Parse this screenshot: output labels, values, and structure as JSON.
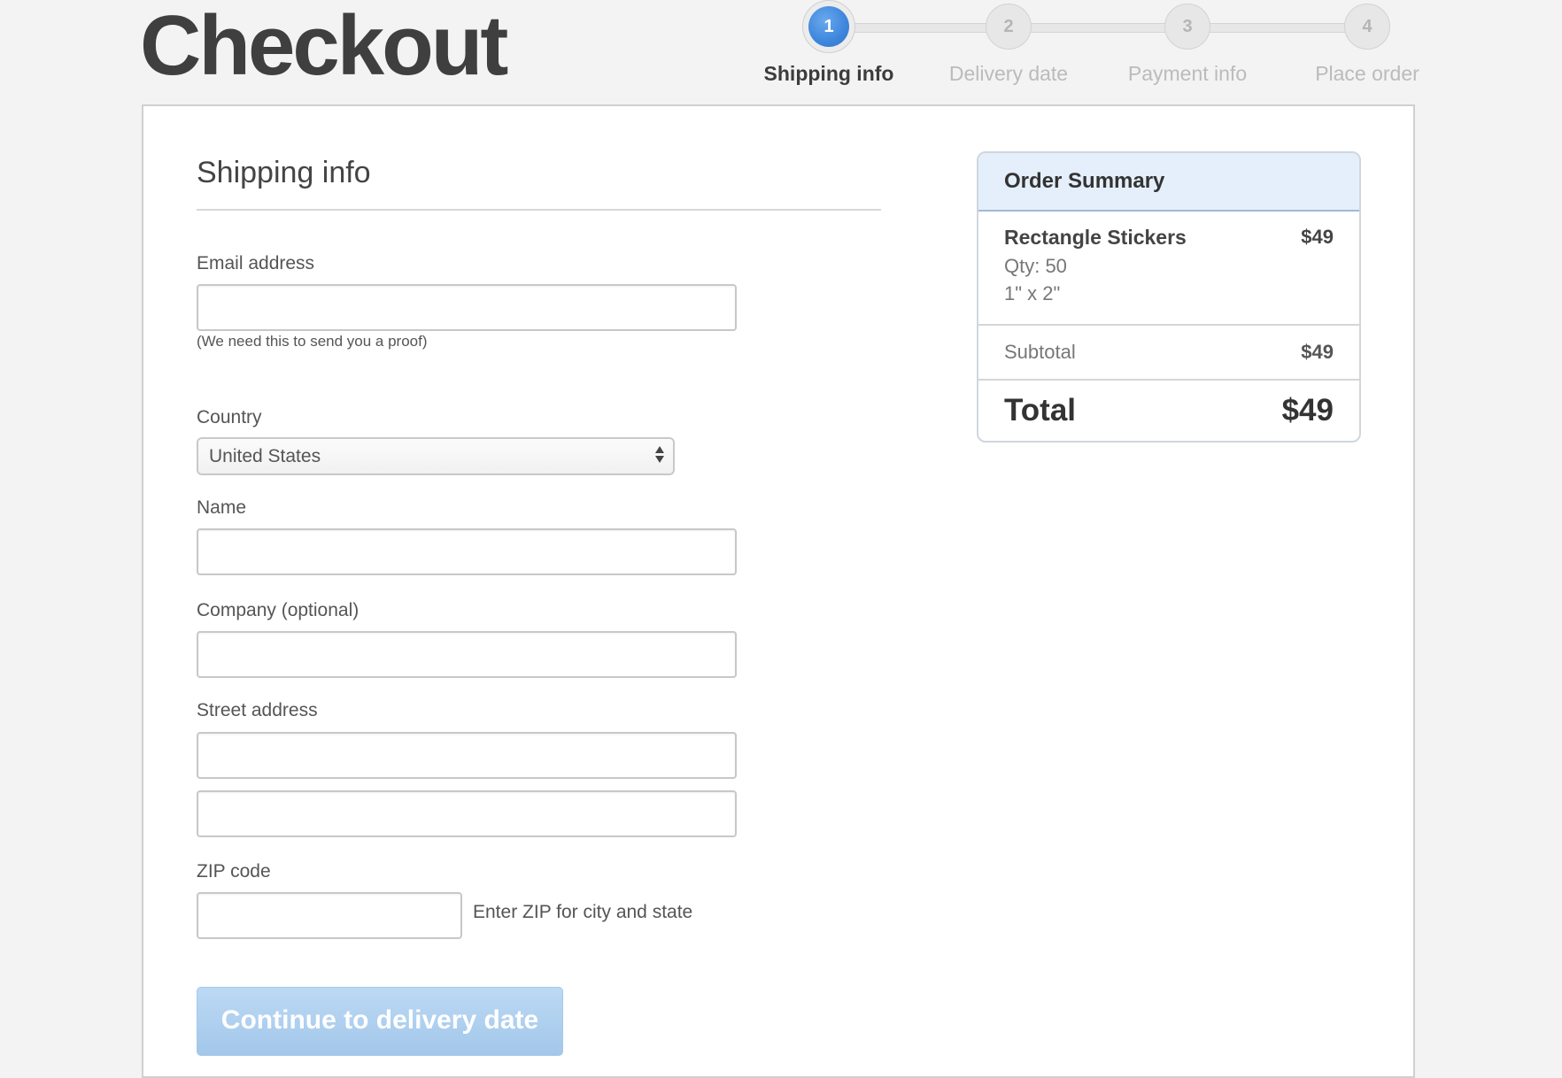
{
  "page": {
    "title": "Checkout"
  },
  "steps": [
    {
      "number": "1",
      "label": "Shipping info",
      "state": "active"
    },
    {
      "number": "2",
      "label": "Delivery date",
      "state": "inactive"
    },
    {
      "number": "3",
      "label": "Payment info",
      "state": "inactive"
    },
    {
      "number": "4",
      "label": "Place order",
      "state": "inactive"
    }
  ],
  "form": {
    "section_title": "Shipping info",
    "email": {
      "label": "Email address",
      "value": "",
      "hint": "(We need this to send you a proof)"
    },
    "country": {
      "label": "Country",
      "selected": "United States"
    },
    "name": {
      "label": "Name",
      "value": ""
    },
    "company": {
      "label": "Company (optional)",
      "value": ""
    },
    "street": {
      "label": "Street address",
      "line1": "",
      "line2": ""
    },
    "zip": {
      "label": "ZIP code",
      "value": "",
      "helper": "Enter ZIP for city and state"
    },
    "continue_label": "Continue to delivery date"
  },
  "summary": {
    "title": "Order Summary",
    "item": {
      "name": "Rectangle Stickers",
      "price": "$49",
      "qty": "Qty: 50",
      "size": "1\" x 2\""
    },
    "subtotal_label": "Subtotal",
    "subtotal_value": "$49",
    "total_label": "Total",
    "total_value": "$49"
  },
  "colors": {
    "active_step": "#3d86dc",
    "button": "#a3c7ea",
    "summary_header": "#e4effb"
  }
}
